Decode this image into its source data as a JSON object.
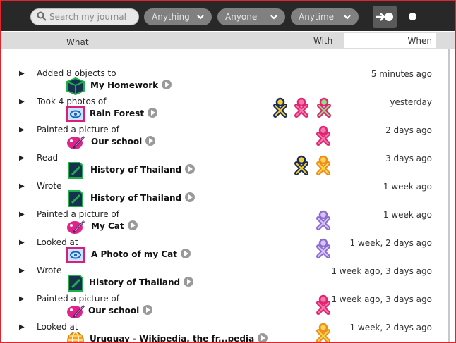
{
  "toolbar": {
    "search_placeholder": "Search my journal",
    "filters": [
      {
        "label": "Anything"
      },
      {
        "label": "Anyone"
      },
      {
        "label": "Anytime"
      }
    ]
  },
  "columns": {
    "what": "What",
    "with": "With",
    "when": "When"
  },
  "colors": {
    "toolbar_bg": "#282828",
    "header_bg": "#dcdcdc",
    "frame": "#e0262a"
  },
  "entries": [
    {
      "action": "Added 8 objects to",
      "title": "My Homework",
      "icon": "folder-icon",
      "when": "5 minutes ago",
      "buddies": []
    },
    {
      "action": "Took 4 photos of",
      "title": "Rain Forest",
      "icon": "image-icon",
      "when": "yesterday",
      "buddies": [
        "navy-yellow",
        "pink-pink",
        "green-pink"
      ]
    },
    {
      "action": "Painted a picture of",
      "title": "Our school",
      "icon": "paint-icon",
      "when": "2 days ago",
      "buddies": [
        "pink-pink"
      ]
    },
    {
      "action": "Read",
      "title": "History of Thailand",
      "icon": "document-icon",
      "when": "3 days ago",
      "buddies": [
        "navy-yellow",
        "orange-yellow"
      ]
    },
    {
      "action": "Wrote",
      "title": "History of Thailand",
      "icon": "document-icon",
      "when": "1 week ago",
      "buddies": []
    },
    {
      "action": "Painted a picture of",
      "title": "My Cat",
      "icon": "paint-icon",
      "when": "1 week ago",
      "buddies": [
        "purple-white"
      ]
    },
    {
      "action": "Looked at",
      "title": "A Photo of my Cat",
      "icon": "image-icon",
      "when": "1 week, 2 days ago",
      "buddies": [
        "purple-white"
      ]
    },
    {
      "action": "Wrote",
      "title": "History of Thailand",
      "icon": "document-icon",
      "when": "1 week ago, 3 days ago",
      "buddies": []
    },
    {
      "action": "Painted a picture of",
      "title": "Our school",
      "icon": "paint-icon",
      "when": "1 week ago, 3 days ago",
      "buddies": [
        "pink-pink"
      ]
    },
    {
      "action": "Looked at",
      "title": "Uruguay - Wikipedia, the fr...pedia",
      "icon": "globe-icon",
      "when": "1 week, 2 days ago",
      "buddies": [
        "orange-yellow"
      ]
    }
  ]
}
